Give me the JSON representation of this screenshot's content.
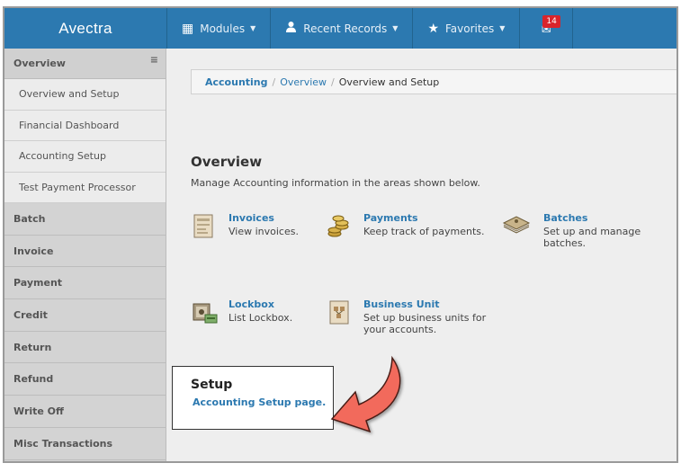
{
  "app": {
    "brand": "Avectra"
  },
  "nav": {
    "modules": "Modules",
    "recent": "Recent Records",
    "favorites": "Favorites",
    "mail_count": "14"
  },
  "sidebar": {
    "header": "Overview",
    "subitems": [
      "Overview and Setup",
      "Financial Dashboard",
      "Accounting Setup",
      "Test Payment Processor"
    ],
    "sections": [
      "Batch",
      "Invoice",
      "Payment",
      "Credit",
      "Return",
      "Refund",
      "Write Off",
      "Misc Transactions"
    ]
  },
  "breadcrumb": {
    "root": "Accounting",
    "mid": "Overview",
    "current": "Overview and Setup",
    "sep": "/"
  },
  "overview": {
    "title": "Overview",
    "description": "Manage Accounting information in the areas shown below."
  },
  "tiles": {
    "invoices": {
      "name": "Invoices",
      "desc": "View invoices."
    },
    "payments": {
      "name": "Payments",
      "desc": "Keep track of payments."
    },
    "batches": {
      "name": "Batches",
      "desc": "Set up and manage batches."
    },
    "lockbox": {
      "name": "Lockbox",
      "desc": "List Lockbox."
    },
    "business_unit": {
      "name": "Business Unit",
      "desc": "Set up business units for your accounts."
    }
  },
  "setup": {
    "title": "Setup",
    "link": "Accounting Setup page."
  },
  "colors": {
    "accent": "#2c79b0",
    "callout_arrow": "#f26b5b"
  }
}
